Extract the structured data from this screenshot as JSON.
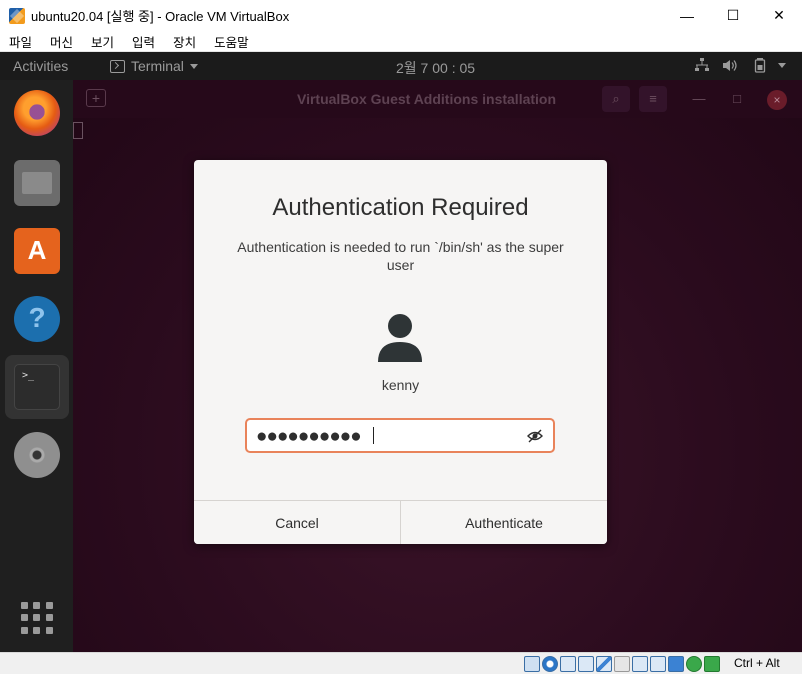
{
  "host_window": {
    "title": "ubuntu20.04 [실행 중] - Oracle VM VirtualBox",
    "controls": {
      "minimize": "—",
      "maximize": "☐",
      "close": "✕"
    },
    "menu": [
      "파일",
      "머신",
      "보기",
      "입력",
      "장치",
      "도움말"
    ],
    "status": {
      "host_key": "Ctrl + Alt"
    }
  },
  "guest_topbar": {
    "activities": "Activities",
    "app_name": "Terminal",
    "clock": "2월 7  00 : 05"
  },
  "dock": {
    "items": [
      "firefox-icon",
      "files-icon",
      "software-icon",
      "help-icon",
      "terminal-icon",
      "dvd-icon",
      "show-apps-icon"
    ],
    "active": "terminal-icon"
  },
  "terminal_window": {
    "title": "VirtualBox Guest Additions installation",
    "new_tab": "+",
    "search": "⌕",
    "menu": "≡",
    "minimize": "—",
    "maximize": "□",
    "close": "×"
  },
  "auth_dialog": {
    "title": "Authentication Required",
    "message": "Authentication is needed to run `/bin/sh' as the super user",
    "username": "kenny",
    "password_mask": "●●●●●●●●●●",
    "cancel_label": "Cancel",
    "authenticate_label": "Authenticate",
    "accent_color": "#e9835a"
  }
}
